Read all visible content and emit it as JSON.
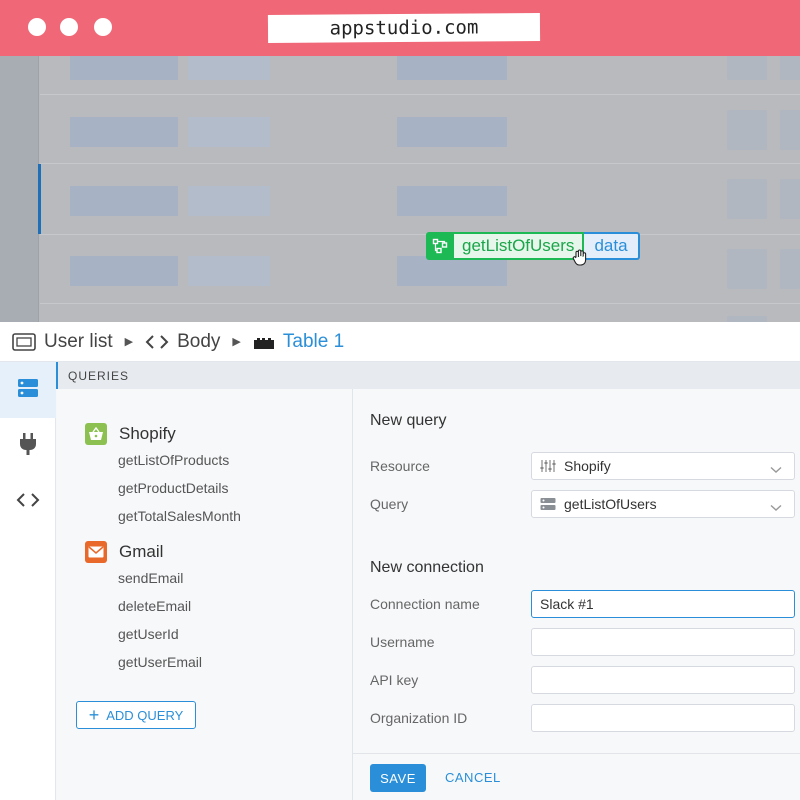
{
  "browser": {
    "url": "appstudio.com"
  },
  "canvas": {
    "binding": {
      "name": "getListOfUsers",
      "field": "data"
    }
  },
  "breadcrumb": {
    "items": [
      {
        "label": "User list",
        "icon": "screen-icon"
      },
      {
        "label": "Body",
        "icon": "code-icon"
      },
      {
        "label": "Table 1",
        "icon": "table-blocks-icon",
        "active": true
      }
    ]
  },
  "sidebar": {
    "items": [
      {
        "icon": "database-icon",
        "active": true
      },
      {
        "icon": "plug-icon"
      },
      {
        "icon": "code-icon"
      }
    ]
  },
  "queries": {
    "header": "QUERIES",
    "sources": [
      {
        "name": "Shopify",
        "icon": "shopping-basket-icon",
        "color": "#8cc152",
        "items": [
          "getListOfProducts",
          "getProductDetails",
          "getTotalSalesMonth"
        ]
      },
      {
        "name": "Gmail",
        "icon": "envelope-icon",
        "color": "#e8692a",
        "items": [
          "sendEmail",
          "deleteEmail",
          "getUserId",
          "getUserEmail"
        ]
      }
    ],
    "add_label": "ADD QUERY"
  },
  "form": {
    "new_query": {
      "title": "New query",
      "resource_label": "Resource",
      "resource_value": "Shopify",
      "query_label": "Query",
      "query_value": "getListOfUsers"
    },
    "new_connection": {
      "title": "New connection",
      "connection_name_label": "Connection name",
      "connection_name_value": "Slack #1",
      "username_label": "Username",
      "username_value": "",
      "api_key_label": "API key",
      "api_key_value": "",
      "organization_id_label": "Organization ID",
      "organization_id_value": ""
    },
    "save_label": "SAVE",
    "cancel_label": "CANCEL"
  },
  "colors": {
    "chrome": "#f06878",
    "accent": "#2a8fd8",
    "binding_green": "#1db954"
  }
}
